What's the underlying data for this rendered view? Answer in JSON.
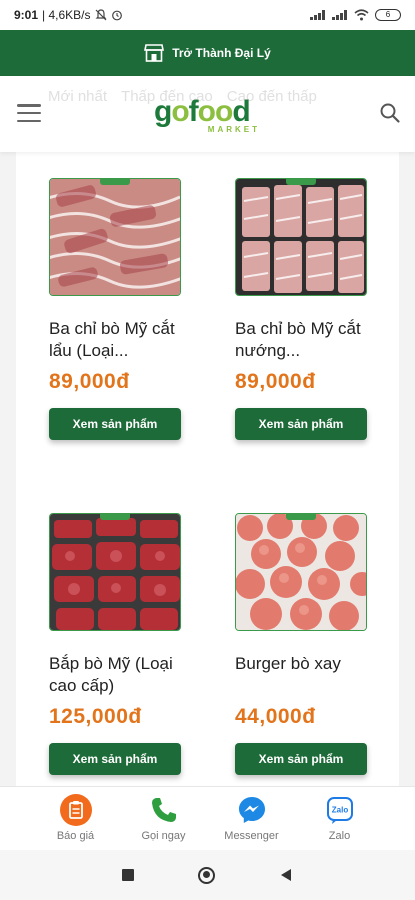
{
  "status_bar": {
    "time": "9:01",
    "network_speed": "| 4,6KB/s",
    "battery": "6"
  },
  "agent_banner": {
    "label": "Trở Thành Đại Lý"
  },
  "header": {
    "sort_tabs": [
      "Mới nhất",
      "Thấp đến cao",
      "Cao đến thấp"
    ],
    "logo_text": "gofood",
    "logo_sub": "MARKET"
  },
  "products": [
    {
      "name": "Ba chỉ bò Mỹ cắt lẩu (Loại...",
      "price": "89,000đ",
      "button": "Xem sản phẩm"
    },
    {
      "name": "Ba chỉ bò Mỹ cắt nướng...",
      "price": "89,000đ",
      "button": "Xem sản phẩm"
    },
    {
      "name": "Bắp bò Mỹ (Loại cao cấp)",
      "price": "125,000đ",
      "button": "Xem sản phẩm"
    },
    {
      "name": "Burger bò xay",
      "price": "44,000đ",
      "button": "Xem sản phẩm"
    }
  ],
  "contact_bar": [
    {
      "label": "Báo giá",
      "icon": "clipboard-icon"
    },
    {
      "label": "Gọi ngay",
      "icon": "phone-icon"
    },
    {
      "label": "Messenger",
      "icon": "messenger-icon"
    },
    {
      "label": "Zalo",
      "icon": "zalo-icon"
    }
  ],
  "colors": {
    "brand_green": "#1d6b38",
    "price_orange": "#e2741c",
    "logo_light_green": "#8cbf3f"
  }
}
